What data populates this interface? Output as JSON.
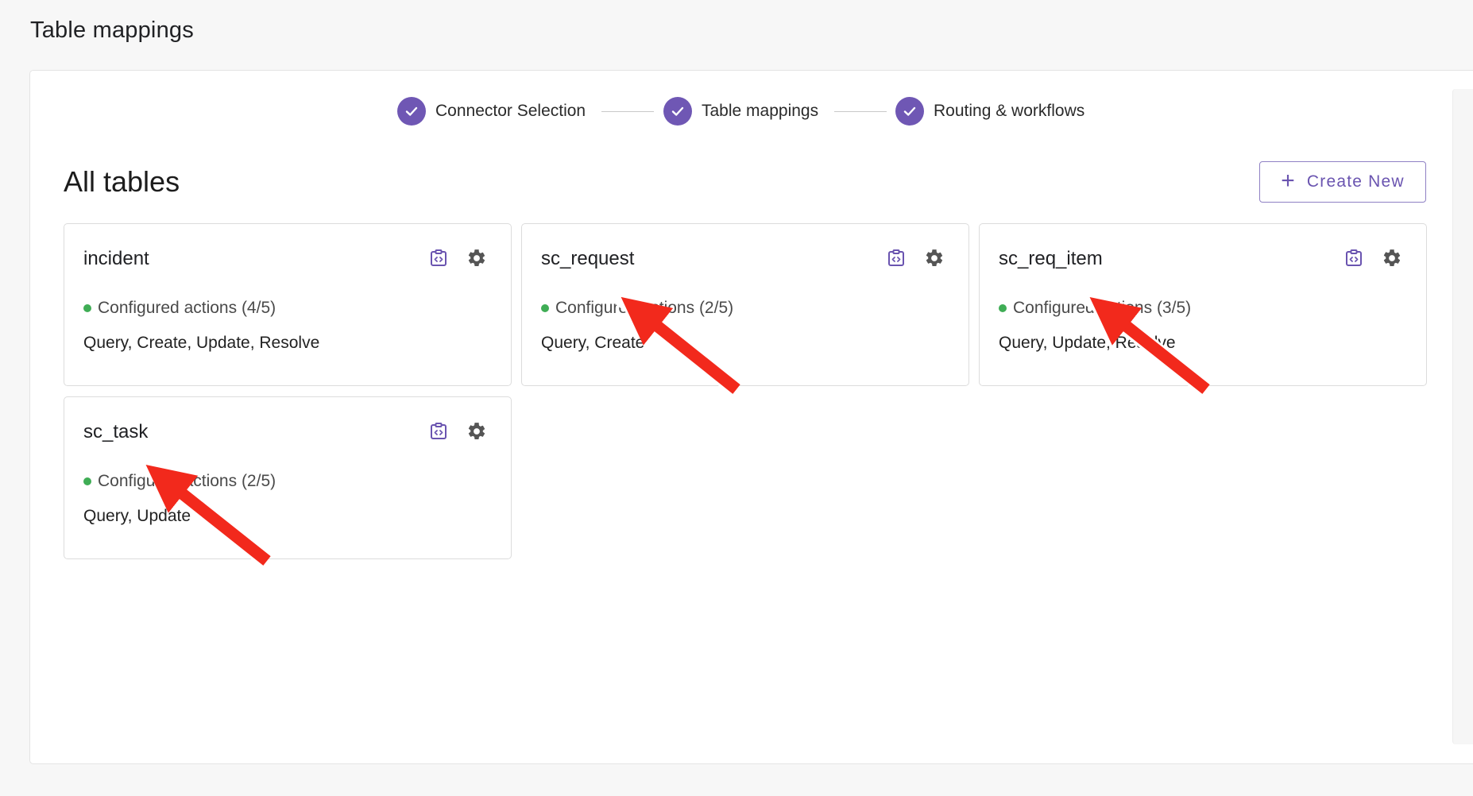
{
  "page": {
    "title": "Table mappings"
  },
  "stepper": {
    "steps": [
      {
        "label": "Connector Selection",
        "state": "complete"
      },
      {
        "label": "Table mappings",
        "state": "complete"
      },
      {
        "label": "Routing & workflows",
        "state": "complete"
      }
    ]
  },
  "section": {
    "title": "All tables",
    "create_label": "Create New"
  },
  "cards": [
    {
      "name": "incident",
      "status": "Configured actions (4/5)",
      "actions": "Query, Create, Update, Resolve"
    },
    {
      "name": "sc_request",
      "status": "Configured actions (2/5)",
      "actions": "Query, Create"
    },
    {
      "name": "sc_req_item",
      "status": "Configured actions (3/5)",
      "actions": "Query, Update, Resolve"
    },
    {
      "name": "sc_task",
      "status": "Configured actions (2/5)",
      "actions": "Query, Update"
    }
  ],
  "colors": {
    "accent": "#6f57b4",
    "status_ok": "#3fad55",
    "annotation_arrow": "#f2291c"
  },
  "icons": {
    "step": "check-icon",
    "card_code": "code-clipboard-icon",
    "card_settings": "gear-icon",
    "create": "plus-icon"
  }
}
